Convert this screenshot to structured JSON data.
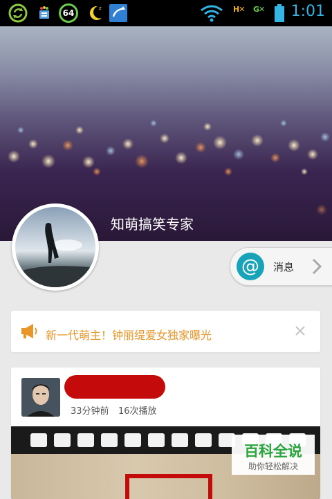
{
  "status_bar": {
    "time": "1:01",
    "battery_badge": "64",
    "icons": [
      "sync-icon",
      "store-icon",
      "battery-64-icon",
      "moon-icon",
      "app-icon",
      "wifi-icon",
      "signal-h-icon",
      "signal-g-icon",
      "battery-icon"
    ]
  },
  "profile": {
    "name": "知萌搞笑专家"
  },
  "message_button": {
    "label": "消息",
    "icon": "at-icon"
  },
  "notice": {
    "text": "新一代萌主！钟丽缇爱女独家曝光",
    "icon": "megaphone-icon"
  },
  "post": {
    "time": "33分钟前",
    "plays": "16次播放"
  },
  "watermark": {
    "title": "百科全说",
    "subtitle": "助你轻松解决"
  },
  "colors": {
    "accent_orange": "#e8962a",
    "at_teal": "#19a3b8",
    "status_blue": "#33b5e5",
    "redact_red": "#c40a0a",
    "watermark_green": "#2aa43c"
  }
}
